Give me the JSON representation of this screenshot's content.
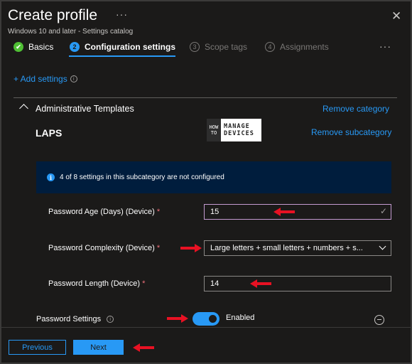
{
  "header": {
    "title": "Create profile",
    "more_icon": "···",
    "close_icon": "✕",
    "subtitle": "Windows 10 and later - Settings catalog"
  },
  "steps": [
    {
      "number": "✔",
      "label": "Basics",
      "state": "completed"
    },
    {
      "number": "2",
      "label": "Configuration settings",
      "state": "current"
    },
    {
      "number": "3",
      "label": "Scope tags",
      "state": "pending"
    },
    {
      "number": "4",
      "label": "Assignments",
      "state": "pending"
    }
  ],
  "steps_more_icon": "···",
  "add_settings": {
    "label": "+ Add settings",
    "info_icon": "i"
  },
  "category": {
    "title": "Administrative Templates",
    "remove_label": "Remove category",
    "subcategory": "LAPS",
    "remove_subcategory_label": "Remove subcategory"
  },
  "logo": {
    "line1": "HOW",
    "line2": "TO",
    "line3": "MANAGE",
    "line4": "DEVICES"
  },
  "banner": {
    "icon": "i",
    "text": "4 of 8 settings in this subcategory are not configured"
  },
  "fields": {
    "age": {
      "label": "Password Age (Days) (Device)",
      "required": "*",
      "value": "15",
      "check_icon": "✓"
    },
    "complexity": {
      "label": "Password Complexity (Device)",
      "required": "*",
      "value": "Large letters + small letters + numbers + s..."
    },
    "length": {
      "label": "Password Length (Device)",
      "required": "*",
      "value": "14"
    }
  },
  "password_settings": {
    "label": "Password Settings",
    "info_icon": "i",
    "toggle_label": "Enabled",
    "toggle_on": true
  },
  "footer": {
    "previous_label": "Previous",
    "next_label": "Next"
  },
  "colors": {
    "accent": "#2899f5",
    "annotation_arrow": "#e81123",
    "background": "#1b1a19"
  }
}
